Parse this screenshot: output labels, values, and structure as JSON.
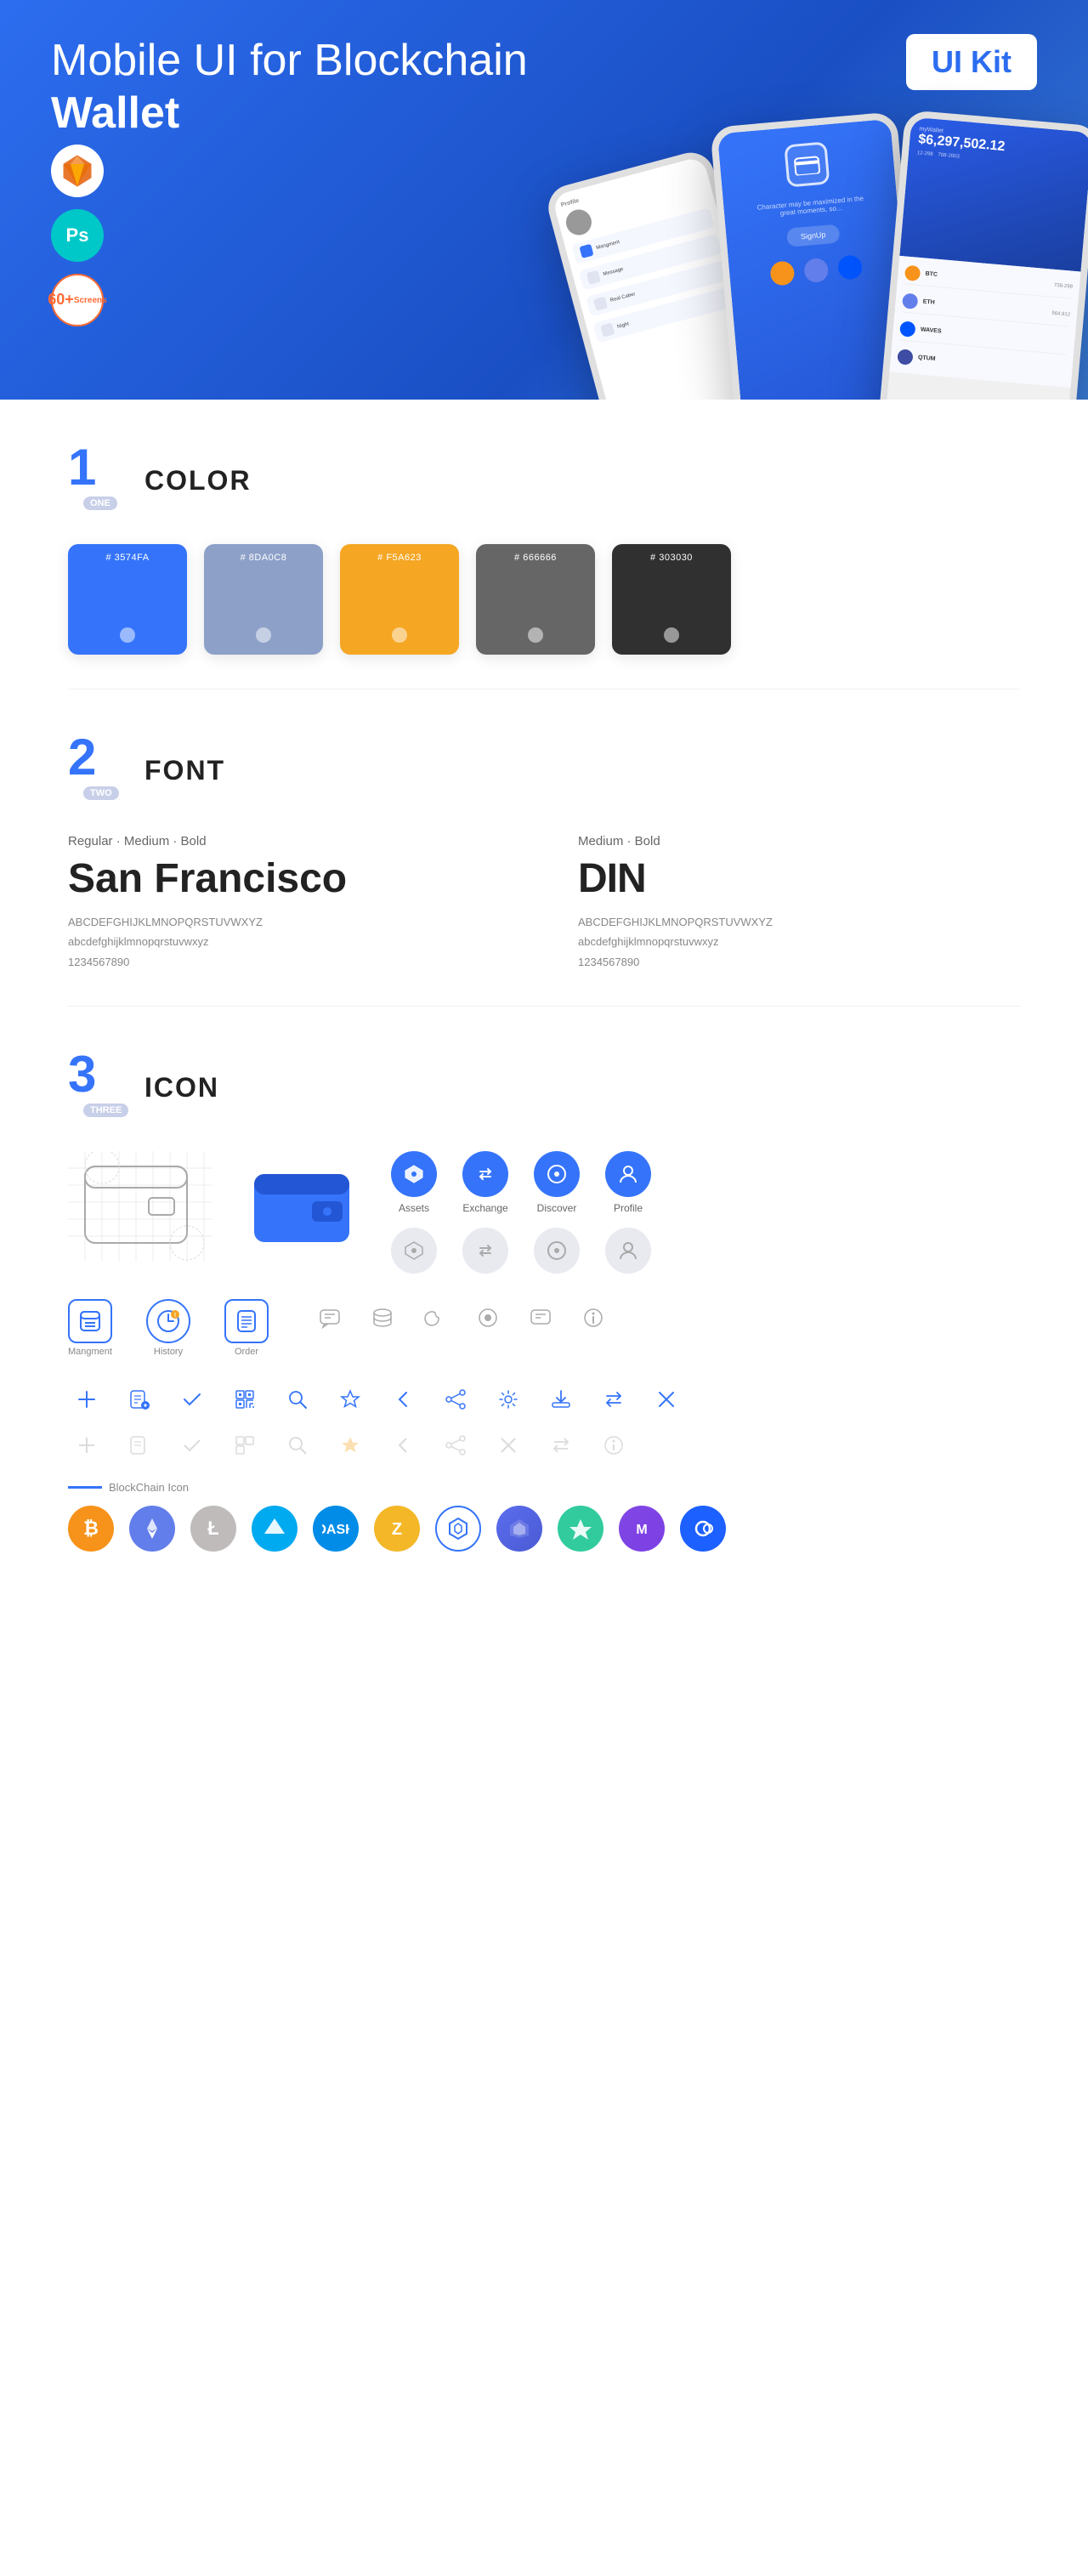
{
  "hero": {
    "title_regular": "Mobile UI for Blockchain ",
    "title_bold": "Wallet",
    "badge": "UI Kit",
    "badges": [
      {
        "id": "sketch",
        "label": "Sketch"
      },
      {
        "id": "ps",
        "label": "Ps"
      },
      {
        "id": "screens",
        "line1": "60+",
        "line2": "Screens"
      }
    ]
  },
  "sections": {
    "color": {
      "number": "1",
      "number_label": "ONE",
      "title": "COLOR",
      "swatches": [
        {
          "hex": "#3574FA",
          "display": "# 3574FA",
          "bg": "#3574FA"
        },
        {
          "hex": "#8DA0C8",
          "display": "# 8DA0C8",
          "bg": "#8DA0C8"
        },
        {
          "hex": "#F5A623",
          "display": "# F5A623",
          "bg": "#F5A623"
        },
        {
          "hex": "#666666",
          "display": "# 666666",
          "bg": "#666666"
        },
        {
          "hex": "#303030",
          "display": "# 303030",
          "bg": "#303030"
        }
      ]
    },
    "font": {
      "number": "2",
      "number_label": "TWO",
      "title": "FONT",
      "fonts": [
        {
          "style_label": "Regular · Medium · Bold",
          "name": "San Francisco",
          "uppercase": "ABCDEFGHIJKLMNOPQRSTUVWXYZ",
          "lowercase": "abcdefghijklmnopqrstuvwxyz",
          "numbers": "1234567890"
        },
        {
          "style_label": "Medium · Bold",
          "name": "DIN",
          "uppercase": "ABCDEFGHIJKLMNOPQRSTUVWXYZ",
          "lowercase": "abcdefghijklmnopqrstuvwxyz",
          "numbers": "1234567890"
        }
      ]
    },
    "icon": {
      "number": "3",
      "number_label": "THREE",
      "title": "ICON",
      "nav_icons": [
        {
          "label": "Assets",
          "icon": "diamond"
        },
        {
          "label": "Exchange",
          "icon": "exchange"
        },
        {
          "label": "Discover",
          "icon": "discover"
        },
        {
          "label": "Profile",
          "icon": "profile"
        }
      ],
      "app_icons": [
        {
          "label": "Mangment",
          "icon": "management"
        },
        {
          "label": "History",
          "icon": "history"
        },
        {
          "label": "Order",
          "icon": "order"
        }
      ],
      "toolbar_icons": [
        "+",
        "list-edit",
        "check",
        "qr",
        "search",
        "star",
        "<",
        "share",
        "gear",
        "download",
        "swap",
        "×"
      ],
      "blockchain_label": "BlockChain Icon",
      "crypto_coins": [
        {
          "name": "Bitcoin",
          "symbol": "₿",
          "bg": "#F7931A",
          "color": "#fff"
        },
        {
          "name": "Ethereum",
          "symbol": "Ξ",
          "bg": "#627EEA",
          "color": "#fff"
        },
        {
          "name": "Litecoin",
          "symbol": "Ł",
          "bg": "#bfbbbb",
          "color": "#fff"
        },
        {
          "name": "Waves",
          "symbol": "W",
          "bg": "#0155ff",
          "color": "#fff"
        },
        {
          "name": "Dash",
          "symbol": "D",
          "bg": "#008CE7",
          "color": "#fff"
        },
        {
          "name": "Zcash",
          "symbol": "Z",
          "bg": "#F4B728",
          "color": "#fff"
        },
        {
          "name": "Grid",
          "symbol": "⬡",
          "bg": "#fff",
          "color": "#3574fa",
          "border": "1px solid #3574fa"
        },
        {
          "name": "Status",
          "symbol": "▲",
          "bg": "#5B6DEE",
          "color": "#fff"
        },
        {
          "name": "Kyber",
          "symbol": "◆",
          "bg": "#31CB9E",
          "color": "#fff"
        },
        {
          "name": "Matic",
          "symbol": "M",
          "bg": "#7b3fe4",
          "color": "#fff"
        },
        {
          "name": "Loopring",
          "symbol": "◎",
          "bg": "#1C60FF",
          "color": "#fff"
        }
      ]
    }
  }
}
